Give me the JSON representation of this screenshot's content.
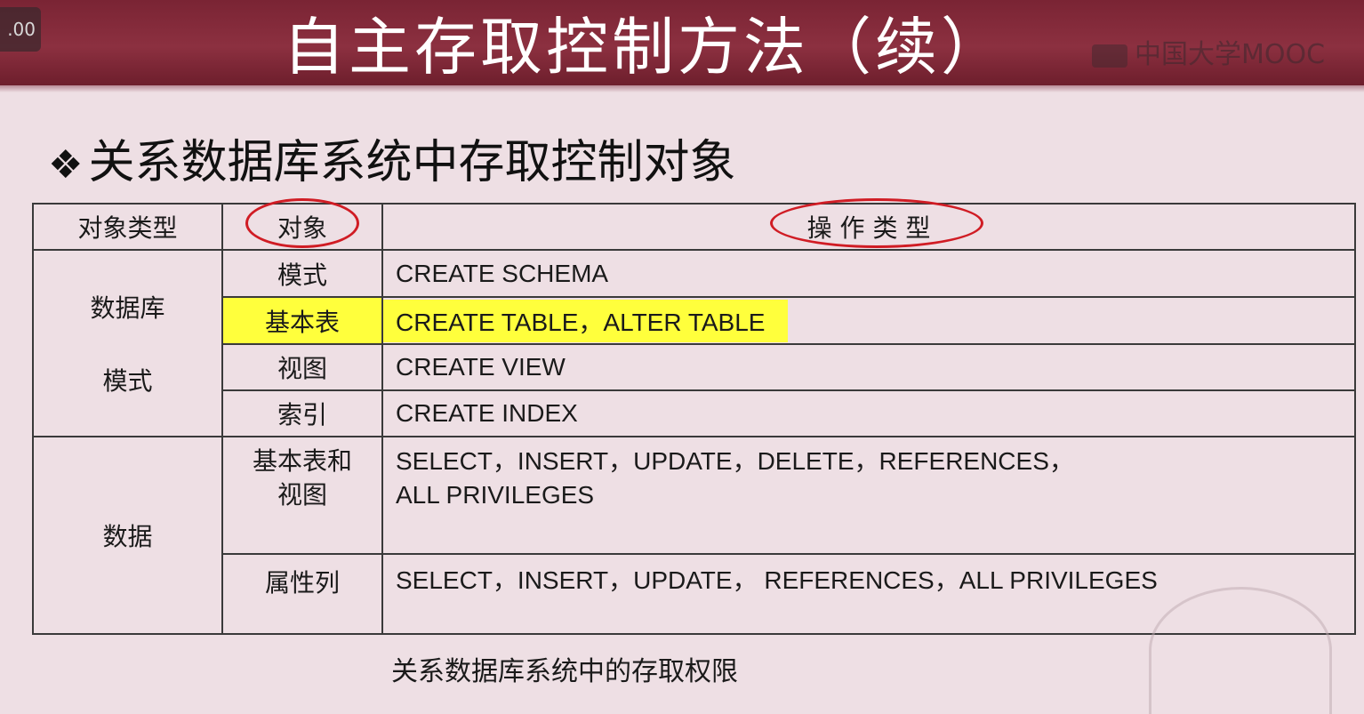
{
  "player": {
    "speed": ".00"
  },
  "slide": {
    "title": "自主存取控制方法（续）",
    "logo": "中国大学MOOC",
    "subheading": "关系数据库系统中存取控制对象",
    "bullet": "❖",
    "caption": "关系数据库系统中的存取权限"
  },
  "table": {
    "headers": {
      "object_type": "对象类型",
      "object": "对象",
      "operation_type": "操 作 类 型"
    },
    "groups": [
      {
        "type_label_1": "数据库",
        "type_label_2": "模式"
      },
      {
        "type_label": "数据"
      }
    ],
    "rows": [
      {
        "object": "模式",
        "operation": "CREATE SCHEMA"
      },
      {
        "object": "基本表",
        "operation": "CREATE TABLE，ALTER TABLE"
      },
      {
        "object": "视图",
        "operation": "CREATE VIEW"
      },
      {
        "object": "索引",
        "operation": "CREATE INDEX"
      },
      {
        "object_line1": "基本表和",
        "object_line2": "视图",
        "operation_line1": "SELECT，INSERT，UPDATE，DELETE，REFERENCES，",
        "operation_line2": "ALL PRIVILEGES"
      },
      {
        "object": "属性列",
        "operation": "SELECT，INSERT，UPDATE， REFERENCES，ALL PRIVILEGES"
      }
    ]
  },
  "colors": {
    "header_bg": "#7a2434",
    "slide_bg": "#eedfe4",
    "highlight": "#ffff3c",
    "annotation_circle": "#d01c24"
  }
}
